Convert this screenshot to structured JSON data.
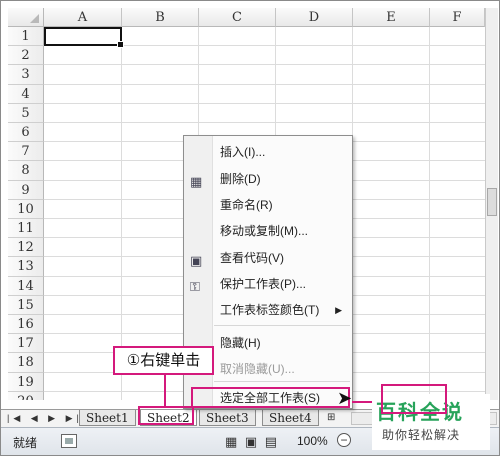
{
  "columns": [
    "A",
    "B",
    "C",
    "D",
    "E",
    "F"
  ],
  "rows": [
    "1",
    "2",
    "3",
    "4",
    "5",
    "6",
    "7",
    "8",
    "9",
    "10",
    "11",
    "12",
    "13",
    "14",
    "15",
    "16",
    "17",
    "18",
    "19",
    "20"
  ],
  "sheet_tabs": [
    "Sheet1",
    "Sheet2",
    "Sheet3",
    "Sheet4"
  ],
  "active_sheet": "Sheet2",
  "context_menu": [
    {
      "label": "插入(I)...",
      "icon": ""
    },
    {
      "label": "删除(D)",
      "icon": "delete-sheet-icon"
    },
    {
      "label": "重命名(R)",
      "icon": ""
    },
    {
      "label": "移动或复制(M)...",
      "icon": ""
    },
    {
      "label": "查看代码(V)",
      "icon": "view-code-icon"
    },
    {
      "label": "保护工作表(P)...",
      "icon": "protect-sheet-icon"
    },
    {
      "label": "工作表标签颜色(T)",
      "icon": "",
      "submenu": true
    },
    {
      "label": "隐藏(H)",
      "icon": ""
    },
    {
      "label": "取消隐藏(U)...",
      "icon": "",
      "disabled": true
    },
    {
      "label": "选定全部工作表(S)",
      "icon": ""
    }
  ],
  "status": {
    "ready": "就绪",
    "zoom": "100%",
    "zoom_minus": "−"
  },
  "annotation": {
    "text": "①右键单击"
  },
  "watermark": {
    "title": "百科全说",
    "subtitle": "助你轻松解决"
  },
  "colors": {
    "accent": "#d4197c",
    "watermark_green": "#27a35a"
  }
}
